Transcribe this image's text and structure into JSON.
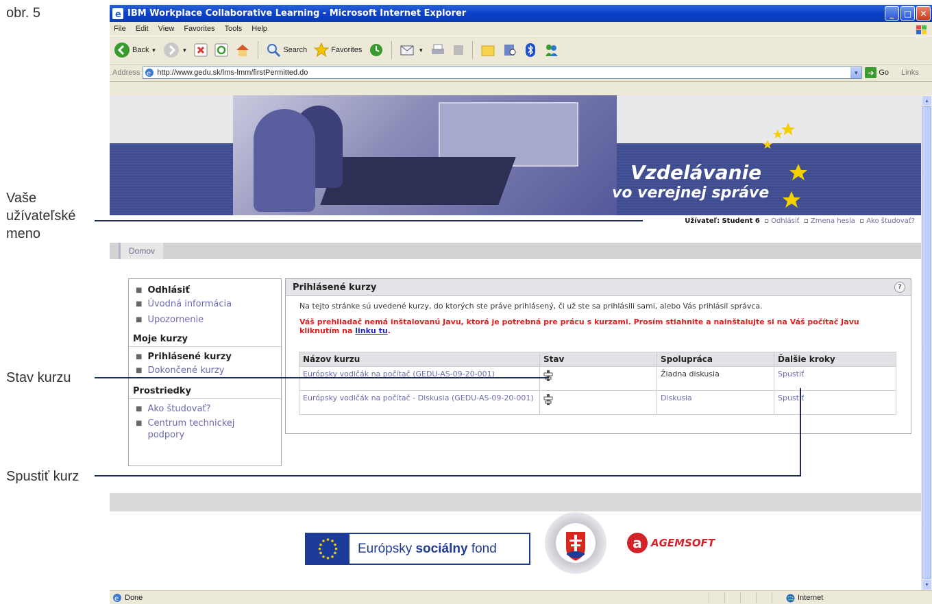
{
  "annotations": {
    "figure": "obr. 5",
    "username_line1": "Vaše",
    "username_line2": "užívateľské",
    "username_line3": "meno",
    "course_status": "Stav kurzu",
    "start_course": "Spustiť kurz"
  },
  "window": {
    "title": "IBM Workplace Collaborative Learning - Microsoft Internet Explorer"
  },
  "menu": [
    "File",
    "Edit",
    "View",
    "Favorites",
    "Tools",
    "Help"
  ],
  "toolbar": {
    "back": "Back",
    "search": "Search",
    "favorites": "Favorites"
  },
  "address": {
    "label": "Address",
    "url": "http://www.gedu.sk/lms-lmm/firstPermitted.do",
    "go": "Go",
    "links": "Links"
  },
  "banner": {
    "line1": "Vzdelávanie",
    "line2": "vo verejnej správe"
  },
  "userbar": {
    "label": "Užívateľ:",
    "name": "Student 6",
    "logout": "Odhlásiť",
    "change_password": "Zmena hesla",
    "how_to": "Ako študovať?"
  },
  "tabs": {
    "home": "Domov"
  },
  "leftnav": {
    "items_top": [
      "Odhlásiť",
      "Úvodná informácia",
      "Upozornenie"
    ],
    "section1": "Moje kurzy",
    "items_courses": [
      "Prihlásené kurzy",
      "Dokončené kurzy"
    ],
    "section2": "Prostriedky",
    "items_resources": [
      "Ako študovať?",
      "Centrum technickej podpory"
    ]
  },
  "panel": {
    "title": "Prihlásené kurzy",
    "help": "?",
    "intro": "Na tejto stránke sú uvedené kurzy, do ktorých ste práve prihlásený, či už ste sa prihlásili sami, alebo Vás prihlásil správca.",
    "warning": "Váš prehliadač nemá inštalovanú Javu, ktorá je potrebná pre prácu s kurzami. Prosím stiahnite a nainštalujte si na Váš počítač Javu kliknutím na",
    "warning_link": "linku tu",
    "table": {
      "headers": [
        "Názov kurzu",
        "Stav",
        "Spolupráca",
        "Ďalšie kroky"
      ],
      "rows": [
        {
          "name": "Európsky vodičák na počítač (GEDU-AS-09-20-001)",
          "collab": "Žiadna diskusia",
          "next": "Spustiť"
        },
        {
          "name": "Európsky vodičák na počítač - Diskusia (GEDU-AS-09-20-001)",
          "collab": "Diskusia",
          "next": "Spustiť"
        }
      ]
    }
  },
  "footer": {
    "esf_pre": "Európsky",
    "esf_bold": "sociálny",
    "esf_post": "fond",
    "agemsoft": "AGEMSOFT"
  },
  "status": {
    "left": "Done",
    "zone": "Internet"
  }
}
